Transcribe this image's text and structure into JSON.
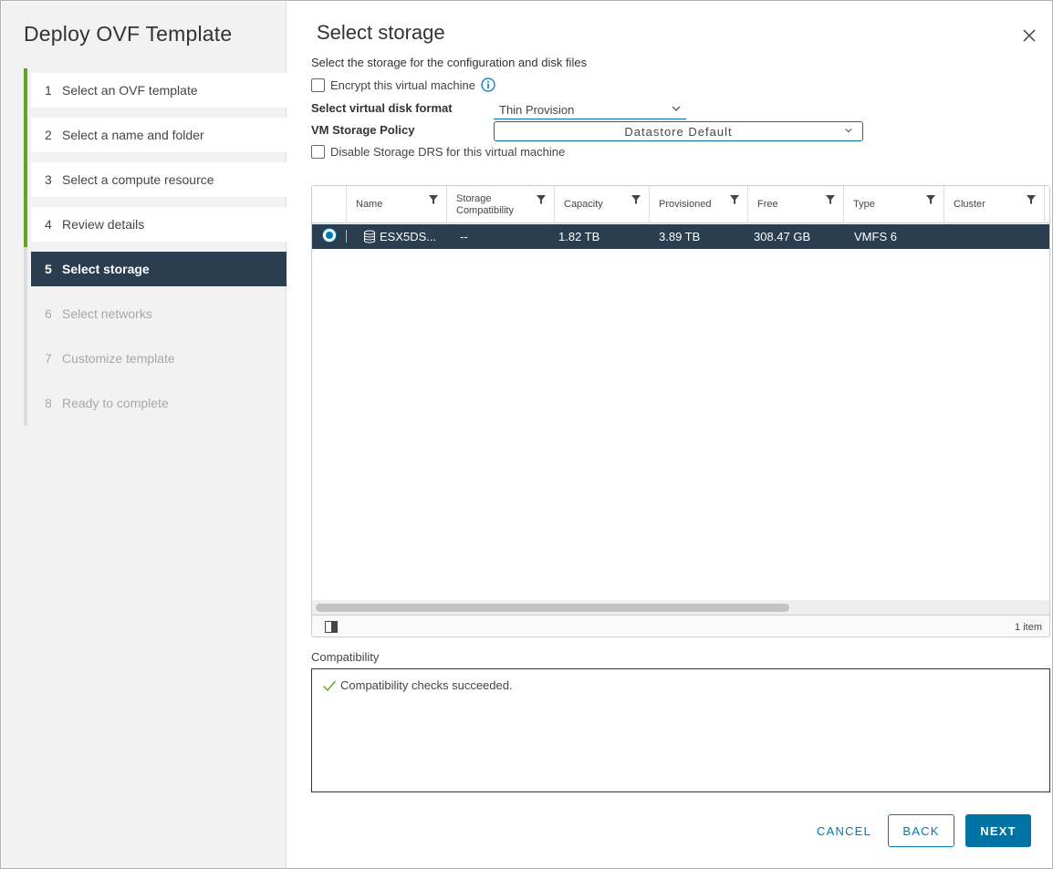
{
  "wizard": {
    "title": "Deploy OVF Template",
    "steps": [
      {
        "num": "1",
        "label": "Select an OVF template",
        "state": "done"
      },
      {
        "num": "2",
        "label": "Select a name and folder",
        "state": "done"
      },
      {
        "num": "3",
        "label": "Select a compute resource",
        "state": "done"
      },
      {
        "num": "4",
        "label": "Review details",
        "state": "done"
      },
      {
        "num": "5",
        "label": "Select storage",
        "state": "current"
      },
      {
        "num": "6",
        "label": "Select networks",
        "state": "pending"
      },
      {
        "num": "7",
        "label": "Customize template",
        "state": "pending"
      },
      {
        "num": "8",
        "label": "Ready to complete",
        "state": "pending"
      }
    ]
  },
  "page": {
    "title": "Select storage",
    "subtitle": "Select the storage for the configuration and disk files",
    "encrypt_label": "Encrypt this virtual machine",
    "encrypt_checked": false,
    "disk_format_label": "Select virtual disk format",
    "disk_format_value": "Thin Provision",
    "policy_label": "VM Storage Policy",
    "policy_value": "Datastore Default",
    "disable_drs_label": "Disable Storage DRS for this virtual machine",
    "disable_drs_checked": false
  },
  "grid": {
    "columns": [
      "Name",
      "Storage Compatibility",
      "Capacity",
      "Provisioned",
      "Free",
      "Type",
      "Cluster"
    ],
    "rows": [
      {
        "selected": true,
        "name": "ESX5DS...",
        "compatibility": "--",
        "capacity": "1.82 TB",
        "provisioned": "3.89 TB",
        "free": "308.47 GB",
        "type": "VMFS 6",
        "cluster": ""
      }
    ],
    "item_count": "1 item"
  },
  "compatibility": {
    "label": "Compatibility",
    "message": "Compatibility checks succeeded."
  },
  "buttons": {
    "cancel": "CANCEL",
    "back": "BACK",
    "next": "NEXT"
  },
  "colors": {
    "accent": "#0072a3",
    "done_bar": "#62a420",
    "current_step_bg": "#2b3e50",
    "selected_row_bg": "#2b3e50"
  }
}
